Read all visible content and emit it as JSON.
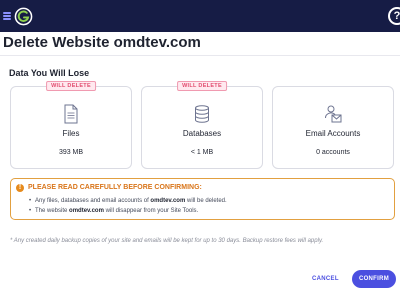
{
  "header": {
    "menu_icon": "hamburger-icon",
    "logo_icon": "siteground-logo",
    "help_icon": "question-circle-icon",
    "help_glyph": "?"
  },
  "page": {
    "title": "Delete Website omdtev.com"
  },
  "data_loss": {
    "heading": "Data You Will Lose",
    "cards": [
      {
        "badge": "WILL DELETE",
        "icon": "file-icon",
        "label": "Files",
        "value": "393 MB"
      },
      {
        "badge": "WILL DELETE",
        "icon": "database-icon",
        "label": "Databases",
        "value": "< 1 MB"
      },
      {
        "badge": "",
        "icon": "email-accounts-icon",
        "label": "Email Accounts",
        "value": "0 accounts"
      }
    ]
  },
  "warning": {
    "icon": "exclamation-icon",
    "glyph": "!",
    "title": "PLEASE READ CAREFULLY BEFORE CONFIRMING:",
    "item1_pre": "Any files, databases and email accounts of ",
    "item1_domain": "omdtev.com",
    "item1_post": " will be deleted.",
    "item2_pre": "The website ",
    "item2_domain": "omdtev.com",
    "item2_post": " will disappear from your Site Tools."
  },
  "footnote": "* Any created daily backup copies of your site and emails will be kept for up to 30 days. Backup restore fees will apply.",
  "actions": {
    "cancel_label": "CANCEL",
    "confirm_label": "CONFIRM"
  },
  "colors": {
    "topbar": "#161c45",
    "accent": "#4b4fe0",
    "warning": "#e2a040",
    "badge": "#e24c6f"
  }
}
